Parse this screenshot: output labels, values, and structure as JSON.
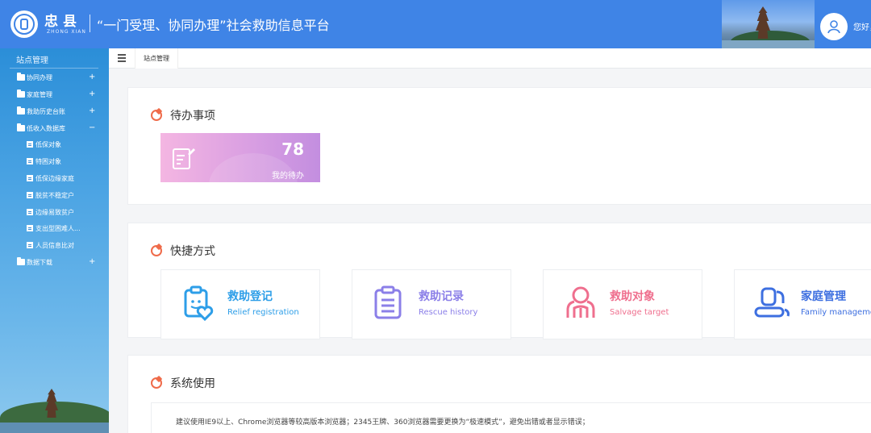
{
  "header": {
    "logo_brand": "忠县",
    "logo_sub": "ZHONG XIAN",
    "title": "“一门受理、协同办理”社会救助信息平台",
    "greeting": "您好，"
  },
  "sidebar": {
    "title": "站点管理",
    "items": [
      {
        "label": "协同办理",
        "toggle": "+"
      },
      {
        "label": "家庭管理",
        "toggle": "+"
      },
      {
        "label": "救助历史台账",
        "toggle": "+"
      },
      {
        "label": "低收入数据库",
        "toggle": "−"
      }
    ],
    "subitems": [
      {
        "label": "低保对象"
      },
      {
        "label": "特困对象"
      },
      {
        "label": "低保边缘家庭"
      },
      {
        "label": "脱贫不稳定户"
      },
      {
        "label": "边缘易致贫户"
      },
      {
        "label": "支出型困难人..."
      },
      {
        "label": "人员信息比对"
      }
    ],
    "last_item": {
      "label": "数据下载",
      "toggle": "+"
    }
  },
  "tabbar": {
    "active_tab": "站点管理"
  },
  "todo_section": {
    "title": "待办事项",
    "card": {
      "count": "78",
      "label": "我的待办"
    }
  },
  "shortcut_section": {
    "title": "快捷方式",
    "items": [
      {
        "title": "救助登记",
        "subtitle": "Relief registration",
        "color": "#2d9ee8",
        "icon": "clipboard-heart-icon"
      },
      {
        "title": "救助记录",
        "subtitle": "Rescue history",
        "color": "#8b7fe8",
        "icon": "clipboard-list-icon"
      },
      {
        "title": "救助对象",
        "subtitle": "Salvage target",
        "color": "#ef6f8e",
        "icon": "people-icon"
      },
      {
        "title": "家庭管理",
        "subtitle": "Family managemer",
        "color": "#3d6fe0",
        "icon": "family-icon"
      }
    ]
  },
  "system_section": {
    "title": "系统使用",
    "notice": "建议使用IE9以上、Chrome浏览器等较高版本浏览器；2345王牌、360浏览器需要更换为“极速模式”，避免出错或者显示错误；"
  },
  "colors": {
    "header_bg": "#3f84e6",
    "accent_icon": "#ef6b4a"
  }
}
